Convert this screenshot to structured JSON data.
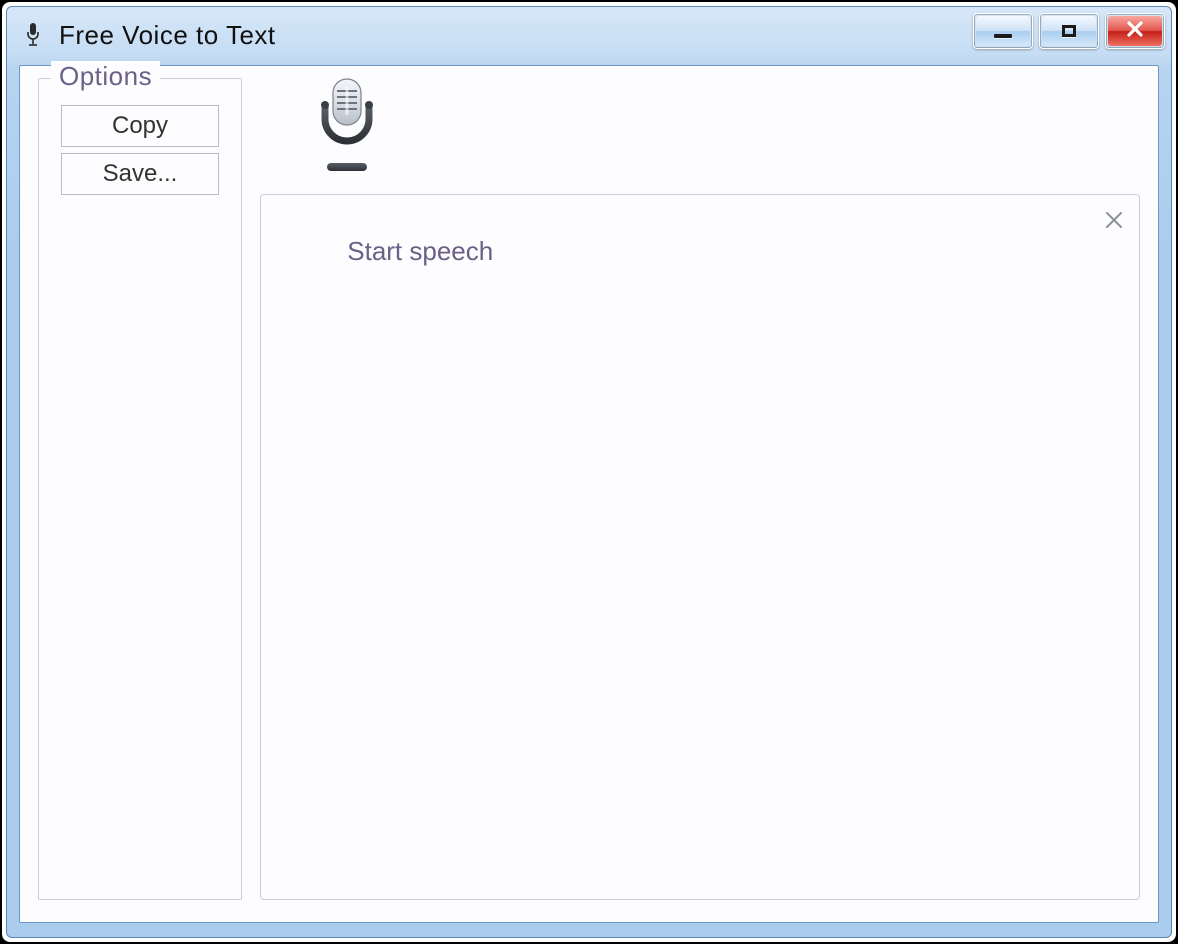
{
  "window": {
    "title": "Free Voice to Text"
  },
  "options": {
    "legend": "Options",
    "copy_label": "Copy",
    "save_label": "Save..."
  },
  "main": {
    "speech_placeholder": "Start speech",
    "speech_text": ""
  }
}
